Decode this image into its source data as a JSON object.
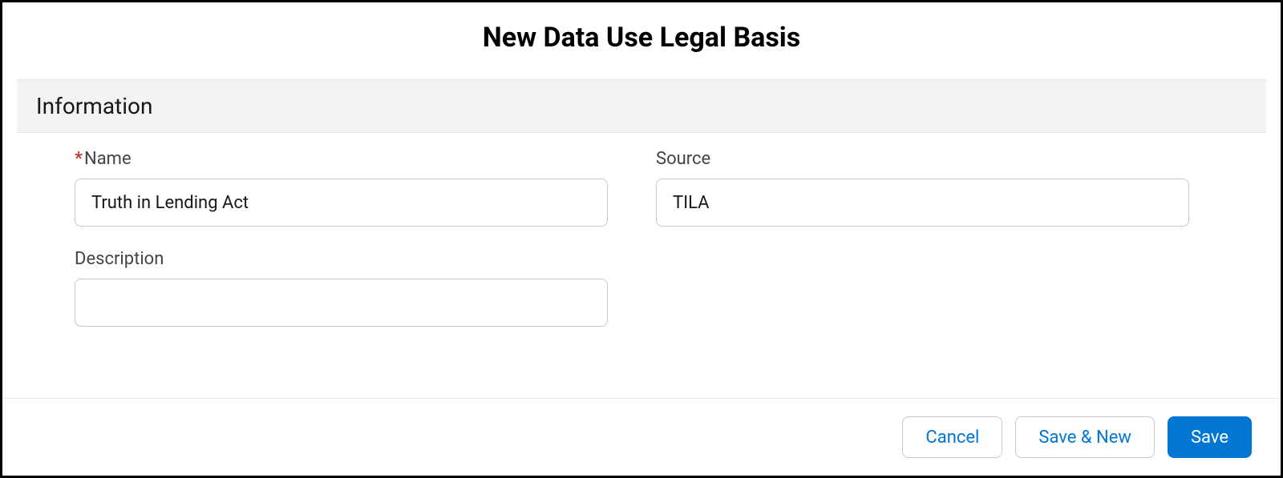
{
  "modal": {
    "title": "New Data Use Legal Basis"
  },
  "section": {
    "title": "Information"
  },
  "fields": {
    "name": {
      "label": "Name",
      "value": "Truth in Lending Act",
      "required": true
    },
    "source": {
      "label": "Source",
      "value": "TILA",
      "required": false
    },
    "description": {
      "label": "Description",
      "value": "",
      "required": false
    }
  },
  "buttons": {
    "cancel": "Cancel",
    "save_new": "Save & New",
    "save": "Save"
  }
}
